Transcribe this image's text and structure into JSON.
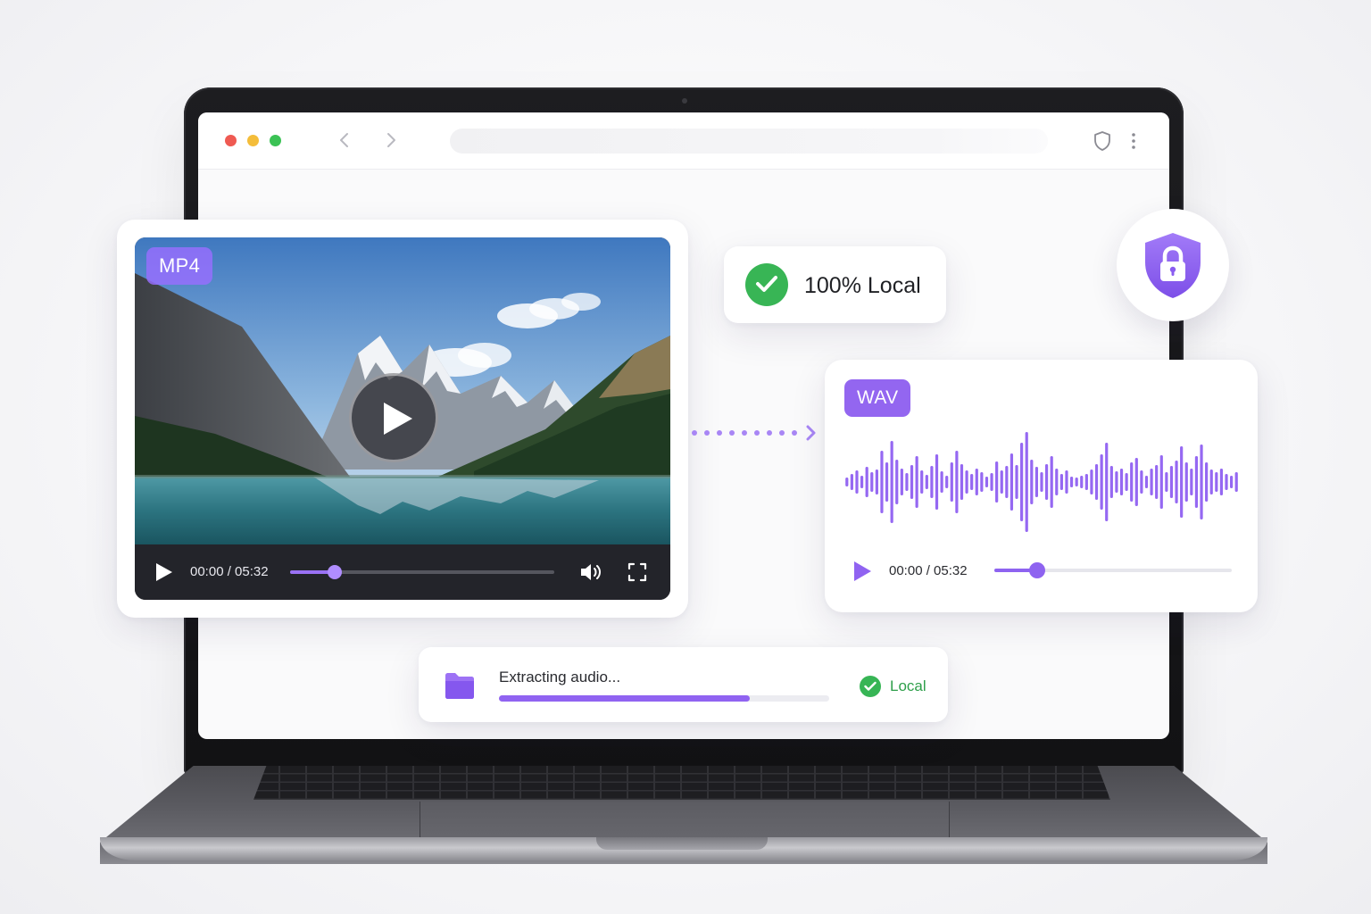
{
  "video_player": {
    "format_badge": "MP4",
    "time": "00:00 / 05:32",
    "progress_fraction": 0.17
  },
  "local_status": {
    "label": "100% Local"
  },
  "audio_player": {
    "format_badge": "WAV",
    "time": "00:00 / 05:32",
    "progress_fraction": 0.18
  },
  "extraction": {
    "label": "Extracting audio...",
    "progress_fraction": 0.76,
    "status": "Local"
  },
  "icons": {
    "nav_back": "chevron-left-icon",
    "nav_forward": "chevron-right-icon",
    "browser_shield": "shield-icon",
    "browser_menu": "kebab-menu-icon",
    "play": "play-icon",
    "volume": "volume-icon",
    "fullscreen": "fullscreen-icon",
    "check": "check-circle-icon",
    "lock_shield": "shield-lock-icon",
    "folder": "folder-icon"
  },
  "colors": {
    "accent_purple": "#9063f1",
    "success_green": "#37b555",
    "traffic_red": "#ef5a52",
    "traffic_yellow": "#f4bd3a",
    "traffic_green": "#3bc255"
  }
}
